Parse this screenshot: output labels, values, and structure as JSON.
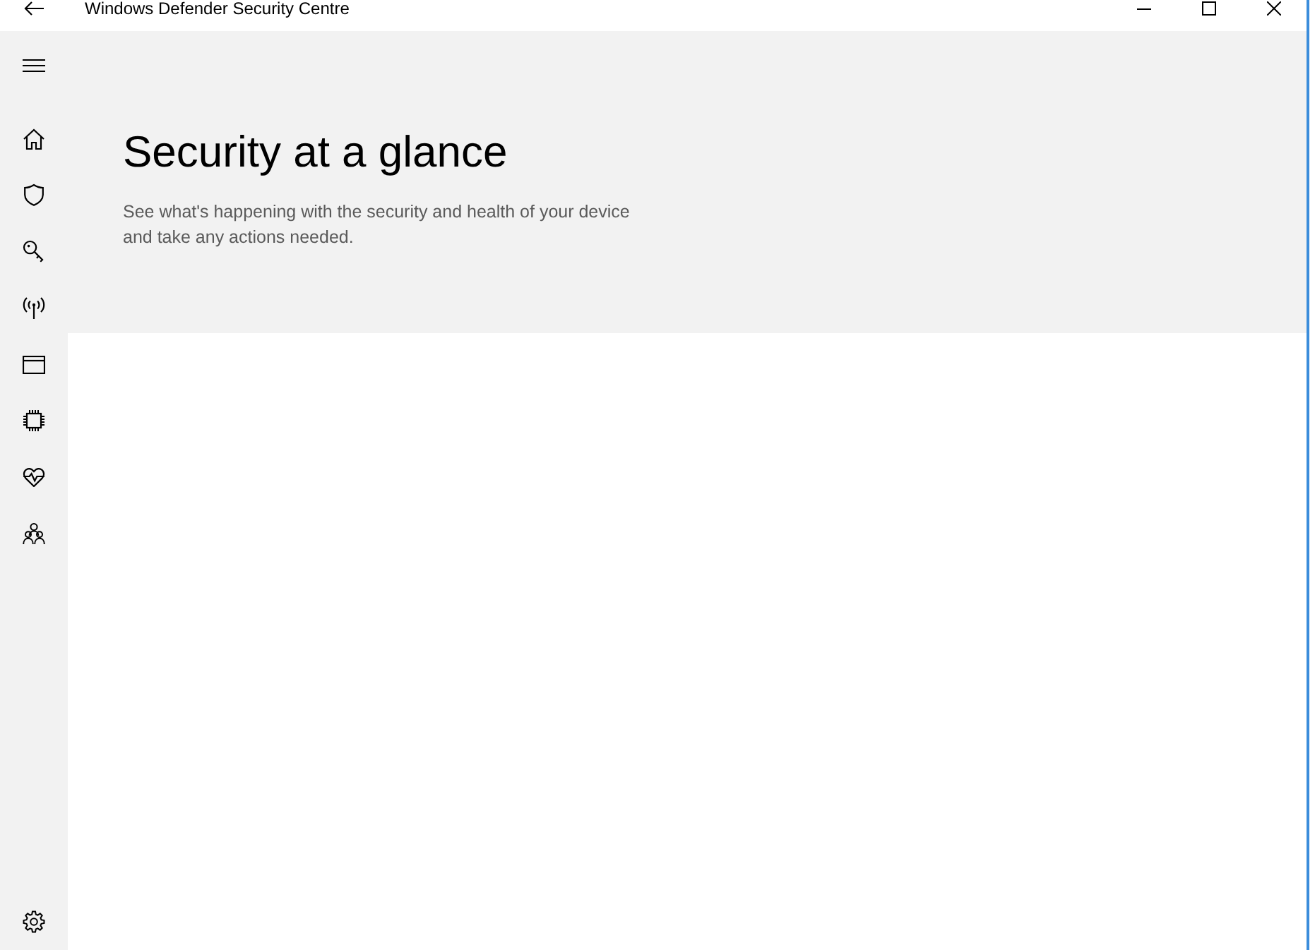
{
  "window": {
    "title": "Windows Defender Security Centre"
  },
  "page": {
    "heading": "Security at a glance",
    "description": "See what's happening with the security and health of your device and take any actions needed."
  }
}
